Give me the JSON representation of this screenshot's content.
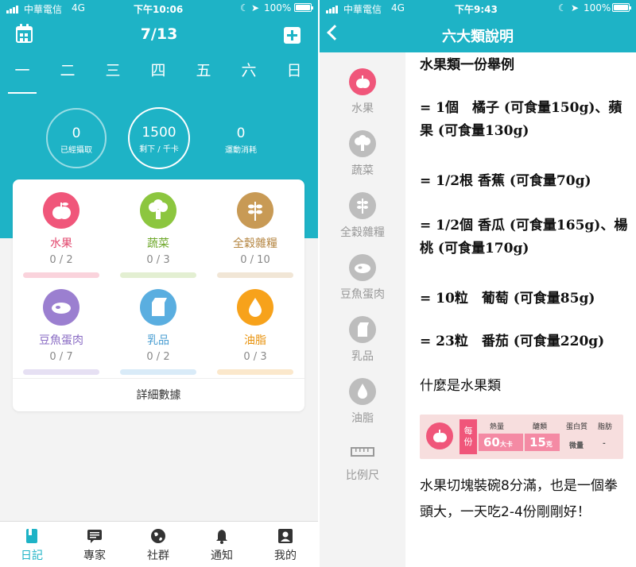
{
  "left": {
    "status": {
      "carrier": "中華電信",
      "network": "4G",
      "time": "下午10:06",
      "battery": "100%"
    },
    "header": {
      "date": "7/13",
      "days": [
        "一",
        "二",
        "三",
        "四",
        "五",
        "六",
        "日"
      ]
    },
    "stats": [
      {
        "value": "0",
        "label": "已經攝取"
      },
      {
        "value": "1500",
        "label": "剩下 / 千卡"
      },
      {
        "value": "0",
        "label": "運動消耗"
      }
    ],
    "foods": [
      {
        "name": "水果",
        "count": "0 / 2",
        "color": "#f0567a",
        "barColor": "#fad3dc",
        "icon": "apple-icon"
      },
      {
        "name": "蔬菜",
        "count": "0 / 3",
        "color": "#8cc63f",
        "barColor": "#e3efd2",
        "icon": "broccoli-icon"
      },
      {
        "name": "全穀雜糧",
        "count": "0 / 10",
        "color": "#c89a55",
        "barColor": "#f1e6d6",
        "icon": "wheat-icon"
      },
      {
        "name": "豆魚蛋肉",
        "count": "0 / 7",
        "color": "#9b7fd0",
        "barColor": "#e6e0f3",
        "icon": "meat-icon"
      },
      {
        "name": "乳品",
        "count": "0 / 2",
        "color": "#5aaee0",
        "barColor": "#d9ebf8",
        "icon": "milk-icon"
      },
      {
        "name": "油脂",
        "count": "0 / 3",
        "color": "#f7a21b",
        "barColor": "#fbe8cc",
        "icon": "oil-drop-icon"
      }
    ],
    "detail_label": "詳細數據",
    "tabs": [
      {
        "label": "日記",
        "icon": "diary-icon"
      },
      {
        "label": "專家",
        "icon": "chat-icon"
      },
      {
        "label": "社群",
        "icon": "globe-icon"
      },
      {
        "label": "通知",
        "icon": "bell-icon"
      },
      {
        "label": "我的",
        "icon": "profile-icon"
      }
    ]
  },
  "right": {
    "status": {
      "carrier": "中華電信",
      "network": "4G",
      "time": "下午9:43",
      "battery": "100%"
    },
    "title": "六大類說明",
    "sidebar": [
      "水果",
      "蔬菜",
      "全穀雜糧",
      "豆魚蛋肉",
      "乳品",
      "油脂",
      "比例尺"
    ],
    "heading": "水果類一份舉例",
    "examples": [
      "= 1個　橘子 (可食量150g)、蘋果 (可食量130g)",
      "= 1/2根 香蕉 (可食量70g)",
      "= 1/2個 香瓜 (可食量165g)、楊桃 (可食量170g)",
      "= 10粒　葡萄 (可食量85g)",
      "= 23粒　番茄 (可食量220g)"
    ],
    "what_is": "什麼是水果類",
    "table": {
      "side": [
        "每",
        "份"
      ],
      "headers": [
        "熱量",
        "醣類",
        "蛋白質",
        "脂肪"
      ],
      "values": [
        "60",
        "15",
        "微量",
        "-"
      ],
      "units": [
        "大卡",
        "克"
      ]
    },
    "description": "水果切塊裝碗8分滿，也是一個拳頭大，一天吃2-4份剛剛好！"
  }
}
